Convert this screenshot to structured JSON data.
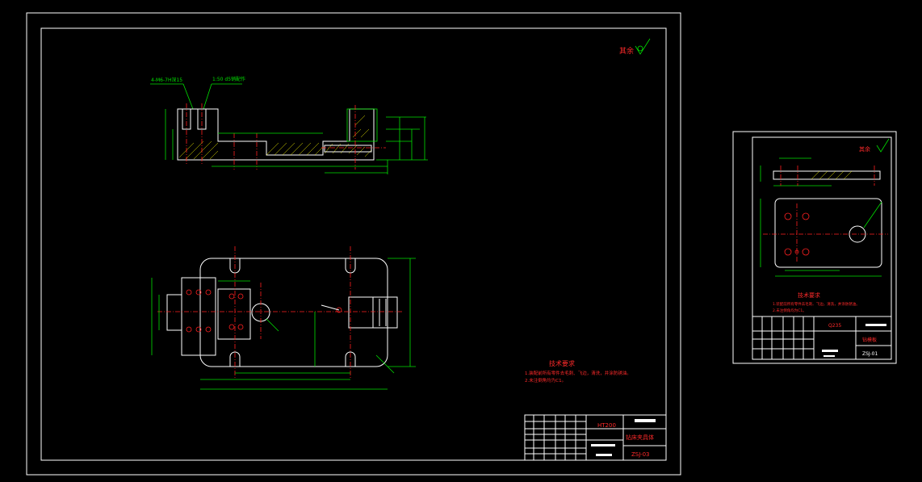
{
  "main_sheet": {
    "roughness_note": "其余",
    "dimension_note_1": "4-M6-7H深15",
    "dimension_note_2": "1:50 d5销配作",
    "tech_req_title": "技术要求",
    "tech_req_1": "1.装配前所有零件去毛刺、飞边，清洗，并涂防锈油。",
    "tech_req_2": "2.未注倒角均为C1。",
    "title_block": {
      "material": "HT200",
      "part_name": "钻床夹具体",
      "drawing_no": "ZSJ-03"
    }
  },
  "thumb_sheet": {
    "roughness_note": "其余",
    "tech_req_title": "技术要求",
    "tech_req_1": "1.装配前所有零件去毛刺、飞边，清洗，并涂防锈油。",
    "tech_req_2": "2.未注倒角均为C1。",
    "title_block": {
      "material": "Q235",
      "part_name": "钻模板",
      "drawing_no": "ZSJ-01"
    }
  }
}
